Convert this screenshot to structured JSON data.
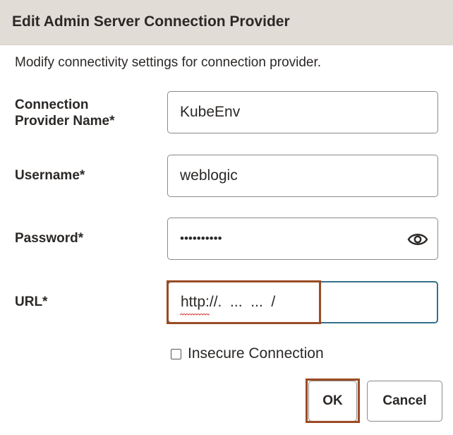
{
  "dialog": {
    "title": "Edit Admin Server Connection Provider",
    "description": "Modify connectivity settings for connection provider."
  },
  "fields": {
    "connection_provider_name": {
      "label_line1": "Connection",
      "label_line2": "Provider Name*",
      "value": "KubeEnv"
    },
    "username": {
      "label": "Username*",
      "value": "weblogic"
    },
    "password": {
      "label": "Password*",
      "value": "••••••••••",
      "toggle_icon": "eye-icon"
    },
    "url": {
      "label": "URL*",
      "value": "http://.  ...  ...  /"
    }
  },
  "insecure_connection": {
    "label": "Insecure Connection",
    "checked": false
  },
  "buttons": {
    "ok_label": "OK",
    "cancel_label": "Cancel"
  },
  "colors": {
    "titlebar_bg": "#e2dcd7",
    "focus_border": "#35708a",
    "highlight_border": "#9a4b25",
    "text": "#2b2826"
  }
}
